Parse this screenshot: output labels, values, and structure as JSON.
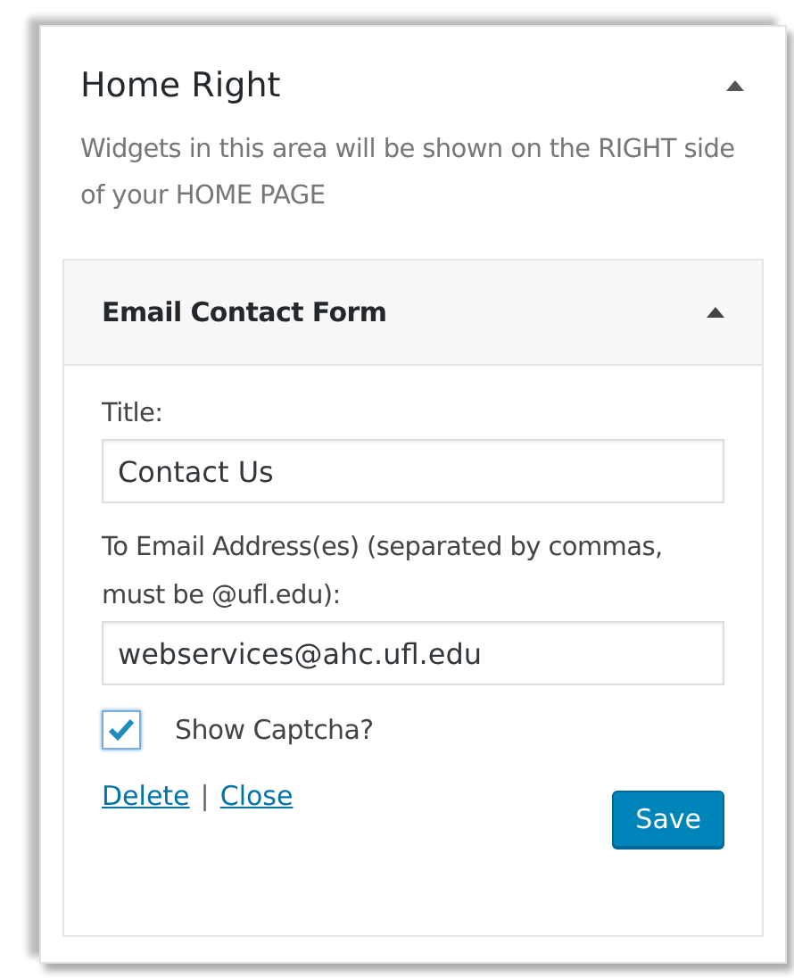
{
  "sidebar": {
    "title": "Home Right",
    "description": "Widgets in this area will be shown on the RIGHT side of your HOME PAGE",
    "expanded": true
  },
  "widget": {
    "title": "Email Contact Form",
    "expanded": true,
    "fields": [
      {
        "label": "Title:",
        "value": "Contact Us"
      },
      {
        "label": "To Email Address(es) (separated by commas, must be @ufl.edu):",
        "value": "webservices@ahc.ufl.edu"
      }
    ],
    "checkbox": {
      "label": "Show Captcha?",
      "checked": true
    },
    "links": [
      "Delete",
      "Close"
    ],
    "separator": "|",
    "save": "Save"
  }
}
